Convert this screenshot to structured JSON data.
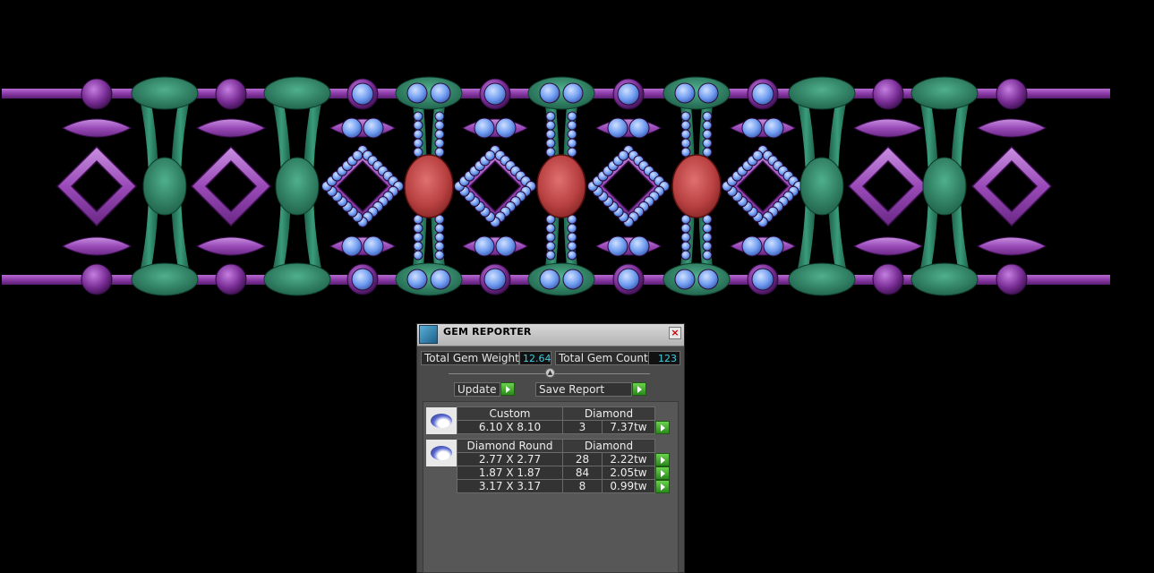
{
  "panel": {
    "title": "GEM REPORTER",
    "total_weight_label": "Total Gem Weight",
    "total_weight_value": "12.64",
    "total_count_label": "Total Gem Count",
    "total_count_value": "123",
    "update_label": "Update",
    "save_report_label": "Save Report"
  },
  "groups": [
    {
      "shape": "Custom",
      "material": "Diamond",
      "rows": [
        {
          "size": "6.10 X 8.10",
          "count": "3",
          "weight": "7.37tw"
        }
      ]
    },
    {
      "shape": "Diamond Round",
      "material": "Diamond",
      "rows": [
        {
          "size": "2.77 X 2.77",
          "count": "28",
          "weight": "2.22tw"
        },
        {
          "size": "1.87 X 1.87",
          "count": "84",
          "weight": "2.05tw"
        },
        {
          "size": "3.17 X 3.17",
          "count": "8",
          "weight": "0.99tw"
        }
      ]
    }
  ],
  "colors": {
    "background": "#000000",
    "metal_purple": "#8e3aa8",
    "metal_green": "#2f8a6c",
    "diamond_blue": "#6f9cf0",
    "ruby_red": "#c04848",
    "panel_gray": "#4a4a4a",
    "value_cyan": "#3cd0e0",
    "go_green": "#3fa82a"
  },
  "icons": [
    "gem-reporter-app-icon",
    "close-icon",
    "slider-knob-icon",
    "play-arrow-icon",
    "gem-thumbnail-icon"
  ]
}
